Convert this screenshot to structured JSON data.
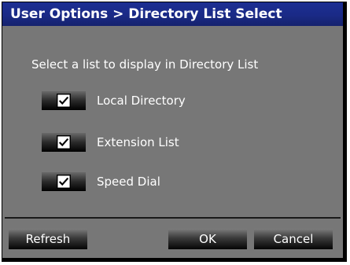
{
  "dialog": {
    "title": "User Options > Directory List Select",
    "instruction": "Select a list to display in Directory List"
  },
  "options": [
    {
      "label": "Local Directory",
      "checked": true
    },
    {
      "label": "Extension List",
      "checked": true
    },
    {
      "label": "Speed Dial",
      "checked": true
    }
  ],
  "buttons": {
    "refresh": "Refresh",
    "ok": "OK",
    "cancel": "Cancel"
  },
  "colors": {
    "title_bar": "#1c2f93",
    "dialog_background": "#777777",
    "button_dark": "#050505"
  }
}
